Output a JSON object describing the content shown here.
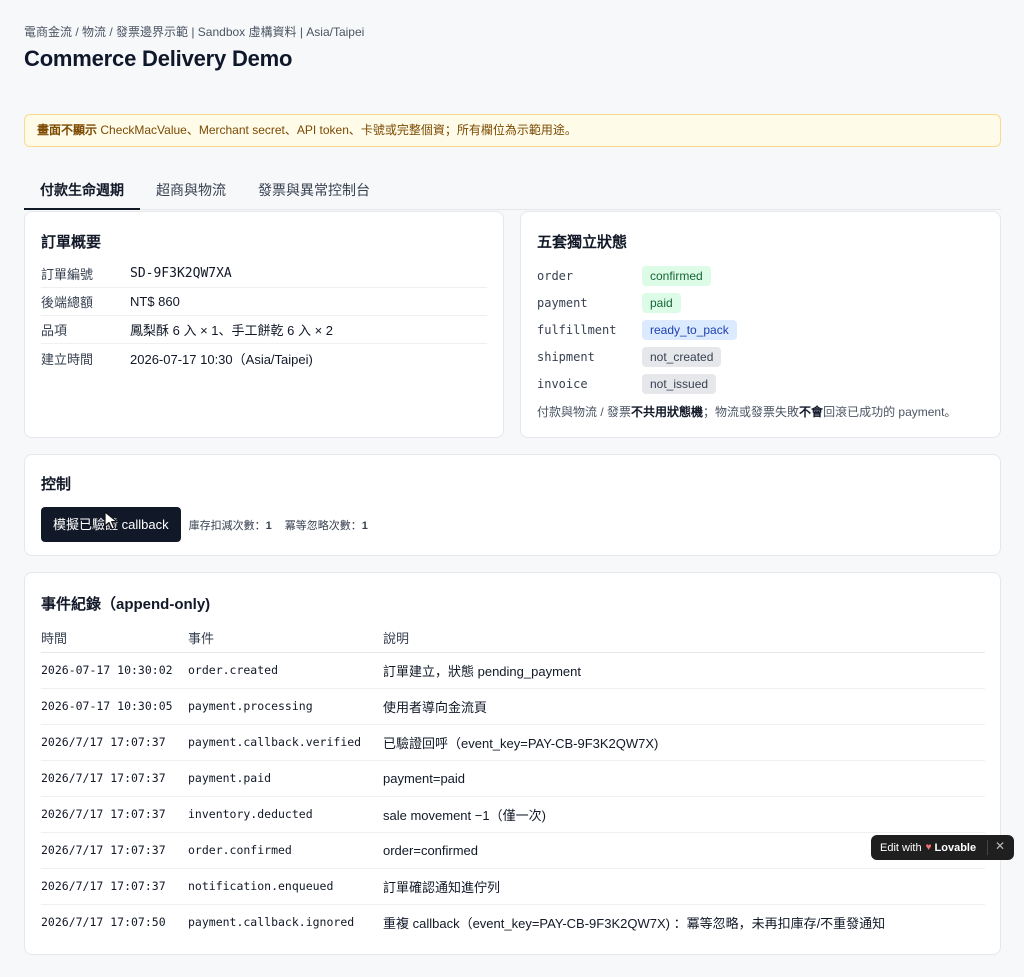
{
  "header": {
    "breadcrumb": "電商金流 / 物流 / 發票邊界示範 | Sandbox 虛構資料 | Asia/Taipei",
    "title": "Commerce Delivery Demo"
  },
  "notice": {
    "bold": "畫面不顯示",
    "text": " CheckMacValue、Merchant secret、API token、卡號或完整個資；所有欄位為示範用途。"
  },
  "tabs": [
    {
      "label": "付款生命週期"
    },
    {
      "label": "超商與物流"
    },
    {
      "label": "發票與異常控制台"
    }
  ],
  "order": {
    "title": "訂單概要",
    "rows": [
      {
        "label": "訂單編號",
        "value": "SD-9F3K2QW7XA"
      },
      {
        "label": "後端總額",
        "value": "NT$ 860"
      },
      {
        "label": "品項",
        "value": "鳳梨酥 6 入 × 1、手工餅乾 6 入 × 2"
      },
      {
        "label": "建立時間",
        "value": "2026-07-17 10:30（Asia/Taipei)"
      }
    ]
  },
  "states": {
    "title": "五套獨立狀態",
    "rows": [
      {
        "key": "order",
        "value": "confirmed",
        "color": "#dcfce7"
      },
      {
        "key": "payment",
        "value": "paid",
        "color": "#dcfce7"
      },
      {
        "key": "fulfillment",
        "value": "ready_to_pack",
        "color": "#dbeafe"
      },
      {
        "key": "shipment",
        "value": "not_created",
        "color": "#e5e7eb"
      },
      {
        "key": "invoice",
        "value": "not_issued",
        "color": "#e5e7eb"
      }
    ],
    "note_pre": "付款與物流 / 發票",
    "note_b1": "不共用狀態機",
    "note_mid": "；物流或發票失敗",
    "note_b2": "不會",
    "note_post": "回滾已成功的 payment。"
  },
  "control": {
    "title": "控制",
    "button_label": "模擬已驗證 callback",
    "stock_label": "庫存扣減次數：",
    "stock_value": "1",
    "idem_label": "冪等忽略次數：",
    "idem_value": "1"
  },
  "events": {
    "title": "事件紀錄（append-only)",
    "columns": [
      "時間",
      "事件",
      "說明"
    ],
    "rows": [
      {
        "time": "2026-07-17 10:30:02",
        "event": "order.created",
        "desc": "訂單建立，狀態 pending_payment"
      },
      {
        "time": "2026-07-17 10:30:05",
        "event": "payment.processing",
        "desc": "使用者導向金流頁"
      },
      {
        "time": "2026/7/17 17:07:37",
        "event": "payment.callback.verified",
        "desc": "已驗證回呼（event_key=PAY-CB-9F3K2QW7X)"
      },
      {
        "time": "2026/7/17 17:07:37",
        "event": "payment.paid",
        "desc": "payment=paid"
      },
      {
        "time": "2026/7/17 17:07:37",
        "event": "inventory.deducted",
        "desc": "sale movement −1（僅一次)"
      },
      {
        "time": "2026/7/17 17:07:37",
        "event": "order.confirmed",
        "desc": "order=confirmed"
      },
      {
        "time": "2026/7/17 17:07:37",
        "event": "notification.enqueued",
        "desc": "訂單確認通知進佇列"
      },
      {
        "time": "2026/7/17 17:07:50",
        "event": "payment.callback.ignored",
        "desc": "重複 callback（event_key=PAY-CB-9F3K2QW7X) ：冪等忽略，未再扣庫存/不重發通知"
      }
    ]
  },
  "lovable": {
    "edit_label": "Edit with",
    "brand": "Lovable",
    "close": "✕"
  }
}
